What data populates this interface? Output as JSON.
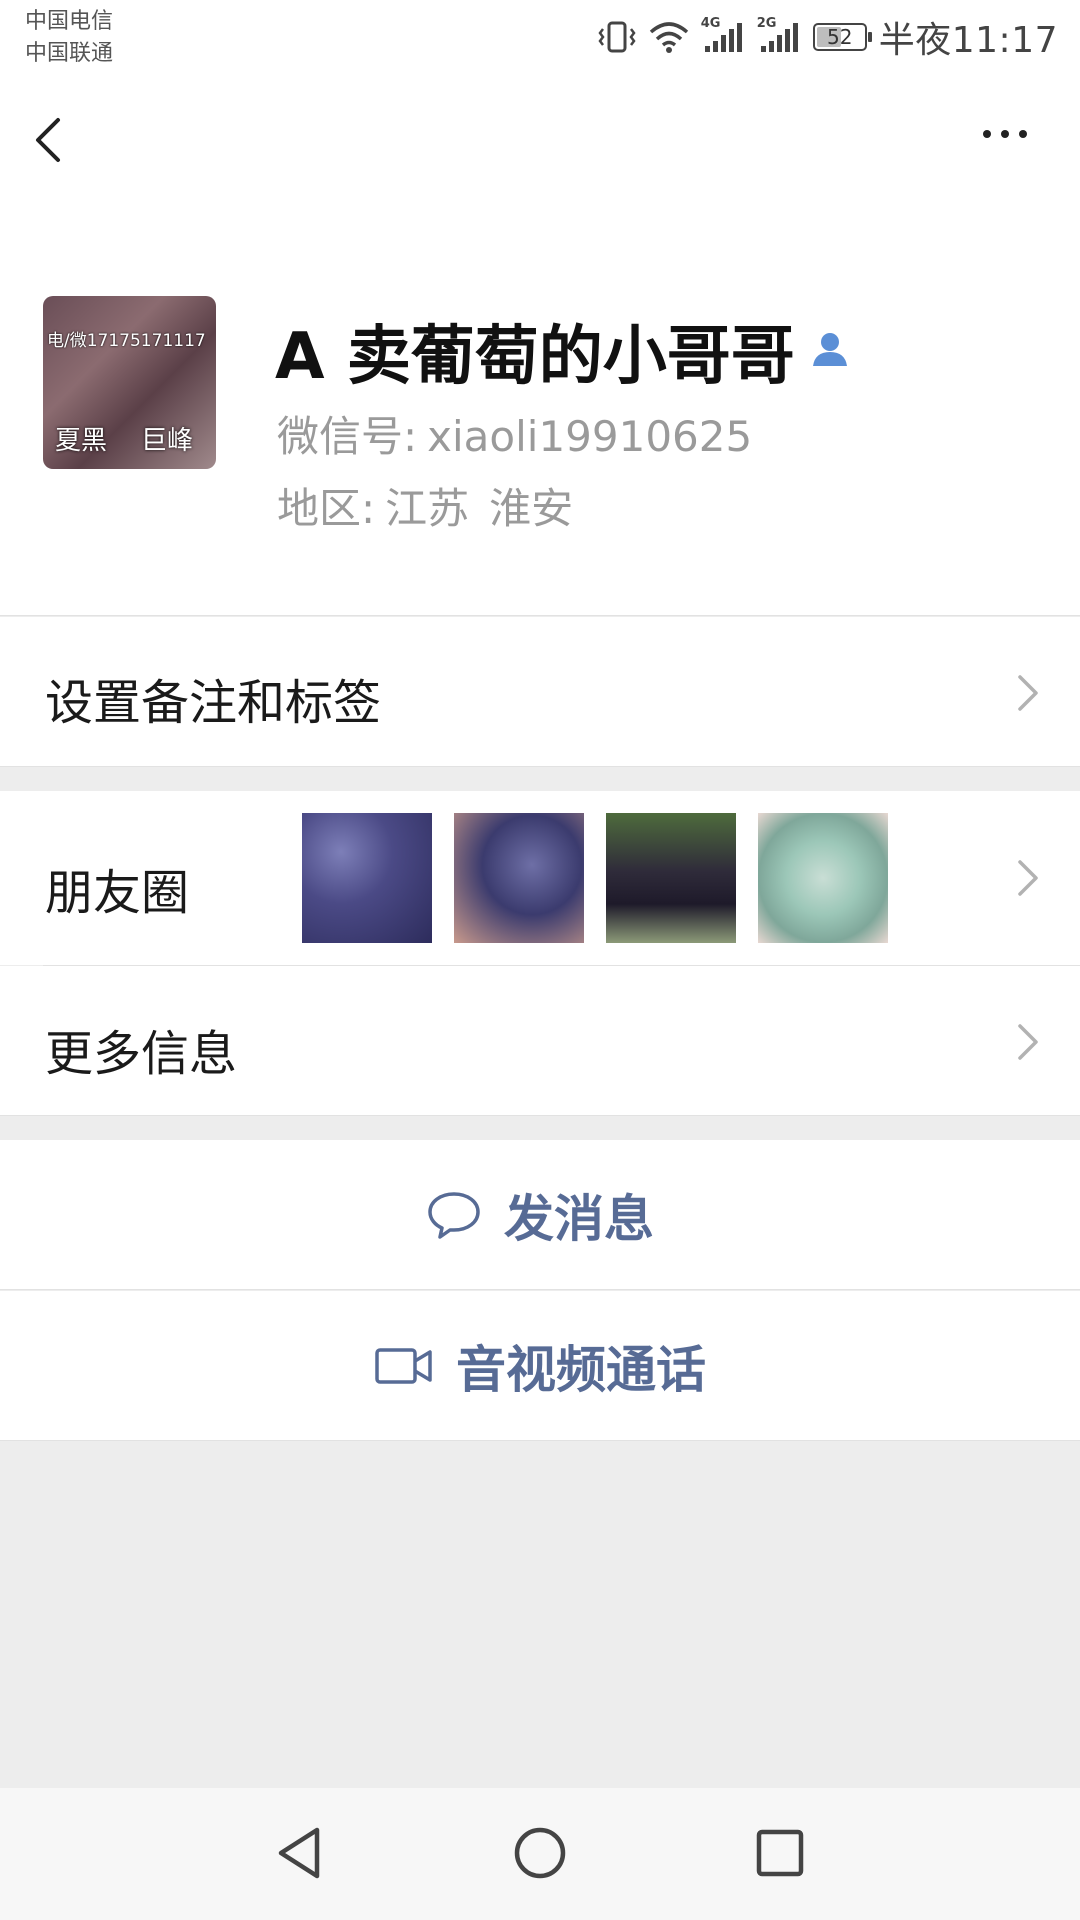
{
  "status_bar": {
    "carrier_1": "中国电信",
    "carrier_2": "中国联通",
    "signal_1": "4G",
    "signal_2": "2G",
    "battery": "52",
    "battery_level": 0.52,
    "time": "半夜11:17"
  },
  "nav": {
    "back_icon": "chevron-left-icon",
    "more_icon": "more-dots-icon"
  },
  "profile": {
    "avatar_text": "电/微17175171117",
    "avatar_label_left": "夏黑",
    "avatar_label_right": "巨峰",
    "name": "A 卖葡萄的小哥哥",
    "wxid_label": "微信号:",
    "wxid": "xiaoli19910625",
    "region_label": "地区:",
    "region_province": "江苏",
    "region_city": "淮安",
    "badge_icon": "contact-person-icon"
  },
  "menu": {
    "remark": "设置备注和标签",
    "moments": "朋友圈",
    "more_info": "更多信息"
  },
  "actions": {
    "message": "发消息",
    "call": "音视频通话"
  },
  "colors": {
    "link": "#576b95",
    "background": "#ededed",
    "cell": "#ffffff"
  }
}
